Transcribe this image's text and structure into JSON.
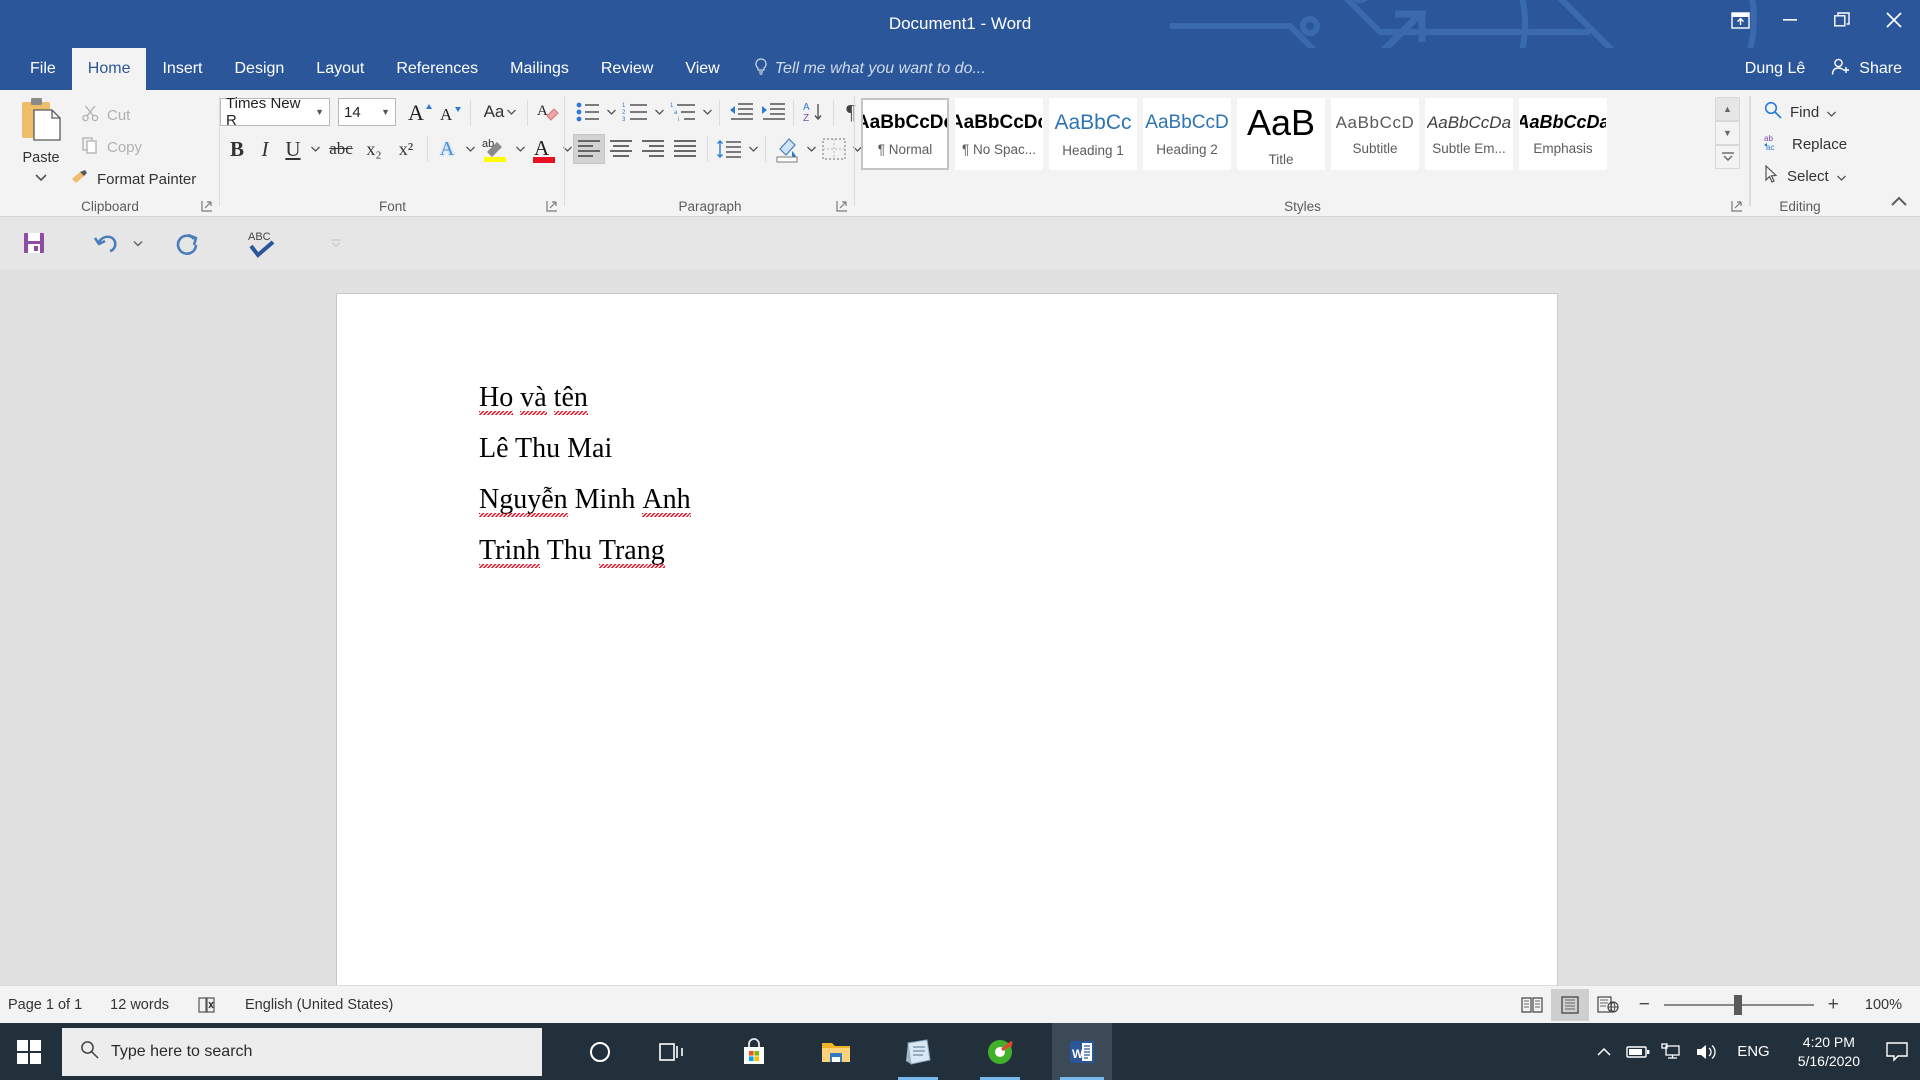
{
  "titlebar": {
    "title": "Document1 - Word",
    "ribbon_display_options": "ribbon-display-options",
    "minimize": "minimize",
    "restore": "restore",
    "close": "close"
  },
  "tabs": [
    {
      "label": "File",
      "active": false
    },
    {
      "label": "Home",
      "active": true
    },
    {
      "label": "Insert",
      "active": false
    },
    {
      "label": "Design",
      "active": false
    },
    {
      "label": "Layout",
      "active": false
    },
    {
      "label": "References",
      "active": false
    },
    {
      "label": "Mailings",
      "active": false
    },
    {
      "label": "Review",
      "active": false
    },
    {
      "label": "View",
      "active": false
    }
  ],
  "tellme": {
    "placeholder": "Tell me what you want to do..."
  },
  "account": {
    "user_name": "Dung Lê",
    "share_label": "Share"
  },
  "ribbon": {
    "clipboard": {
      "group_label": "Clipboard",
      "paste_label": "Paste",
      "cut_label": "Cut",
      "copy_label": "Copy",
      "format_painter_label": "Format Painter"
    },
    "font": {
      "group_label": "Font",
      "font_name": "Times New R",
      "font_size": "14",
      "grow_font": "grow-font",
      "shrink_font": "shrink-font",
      "change_case": "Aa",
      "clear_formatting": "clear-formatting",
      "bold": "B",
      "italic": "I",
      "underline": "U",
      "strikethrough": "abc",
      "subscript": "x₂",
      "superscript": "x²",
      "text_effects": "A",
      "highlight": "ab",
      "font_color": "A"
    },
    "paragraph": {
      "group_label": "Paragraph",
      "bullets": "bullets",
      "numbering": "numbering",
      "multilevel_list": "multilevel-list",
      "decrease_indent": "decrease-indent",
      "increase_indent": "increase-indent",
      "sort": "sort",
      "show_marks": "¶",
      "align_left": "align-left",
      "align_center": "align-center",
      "align_right": "align-right",
      "justify": "justify",
      "line_spacing": "line-spacing",
      "shading": "shading",
      "borders": "borders"
    },
    "styles": {
      "group_label": "Styles",
      "items": [
        {
          "sample": "AaBbCcDc",
          "name": "¶ Normal",
          "selected": true,
          "color": "#000000",
          "weight": "bold",
          "style": "normal",
          "size": "19px"
        },
        {
          "sample": "AaBbCcDc",
          "name": "¶ No Spac...",
          "selected": false,
          "color": "#000000",
          "weight": "bold",
          "style": "normal",
          "size": "19px"
        },
        {
          "sample": "AaBbCc",
          "name": "Heading 1",
          "selected": false,
          "color": "#2e74b5",
          "weight": "normal",
          "style": "normal",
          "size": "21px"
        },
        {
          "sample": "AaBbCcD",
          "name": "Heading 2",
          "selected": false,
          "color": "#2e74b5",
          "weight": "normal",
          "style": "normal",
          "size": "19px"
        },
        {
          "sample": "AaB",
          "name": "Title",
          "selected": false,
          "color": "#000000",
          "weight": "normal",
          "style": "normal",
          "size": "36px"
        },
        {
          "sample": "AaBbCcD",
          "name": "Subtitle",
          "selected": false,
          "color": "#5a5a5a",
          "weight": "normal",
          "style": "normal",
          "size": "17px"
        },
        {
          "sample": "AaBbCcDa",
          "name": "Subtle Em...",
          "selected": false,
          "color": "#404040",
          "weight": "normal",
          "style": "italic",
          "size": "17px"
        },
        {
          "sample": "AaBbCcDa",
          "name": "Emphasis",
          "selected": false,
          "color": "#000000",
          "weight": "bold",
          "style": "italic",
          "size": "18px"
        }
      ]
    },
    "editing": {
      "group_label": "Editing",
      "find_label": "Find",
      "replace_label": "Replace",
      "select_label": "Select"
    },
    "collapse_ribbon": "collapse-ribbon"
  },
  "quick_access": {
    "save": "save",
    "undo": "undo",
    "redo": "redo",
    "spelling": "spelling-and-grammar",
    "customize": "customize-quick-access-toolbar"
  },
  "document": {
    "lines": [
      {
        "text": "Ho và tên",
        "misspelled": [
          "Ho",
          "và",
          "tên"
        ]
      },
      {
        "text": "Lê Thu Mai",
        "misspelled": []
      },
      {
        "text": "Nguyễn Minh Anh",
        "misspelled": [
          "Nguyễn",
          "Anh"
        ]
      },
      {
        "text": "Trinh Thu Trang",
        "misspelled": [
          "Trinh",
          "Trang"
        ]
      }
    ],
    "line1_w1": "Ho",
    "line1_w2": "và",
    "line1_w3": "tên",
    "line2_text": "Lê Thu Mai",
    "line3_w1": "Nguyễn",
    "line3_mid": " Minh ",
    "line3_w2": "Anh",
    "line4_w1": "Trinh",
    "line4_mid": " Thu ",
    "line4_w2": "Trang"
  },
  "statusbar": {
    "page": "Page 1 of 1",
    "words": "12 words",
    "proofing_icon": "proofing-errors-icon",
    "language": "English (United States)",
    "read_mode": "read-mode",
    "print_layout": "print-layout",
    "web_layout": "web-layout",
    "zoom_out": "−",
    "zoom_in": "+",
    "zoom_level": "100%"
  },
  "taskbar": {
    "start": "start-button",
    "search_placeholder": "Type here to search",
    "cortana": "cortana-icon",
    "task_view": "task-view-icon",
    "store": "microsoft-store-icon",
    "file_explorer": "file-explorer-icon",
    "sticky_notes": "sticky-notes-icon",
    "recorder": "screen-recorder-icon",
    "word": "word-icon",
    "tray_chevron": "show-hidden-icons",
    "battery": "battery-icon",
    "network": "network-icon",
    "volume": "volume-icon",
    "language": "ENG",
    "time": "4:20 PM",
    "date": "5/16/2020",
    "action_center": "action-center-icon"
  },
  "colors": {
    "word_blue": "#2b579a",
    "ribbon_bg": "#f3f3f3",
    "taskbar_bg": "#22303c",
    "spell_red": "#e81123"
  }
}
